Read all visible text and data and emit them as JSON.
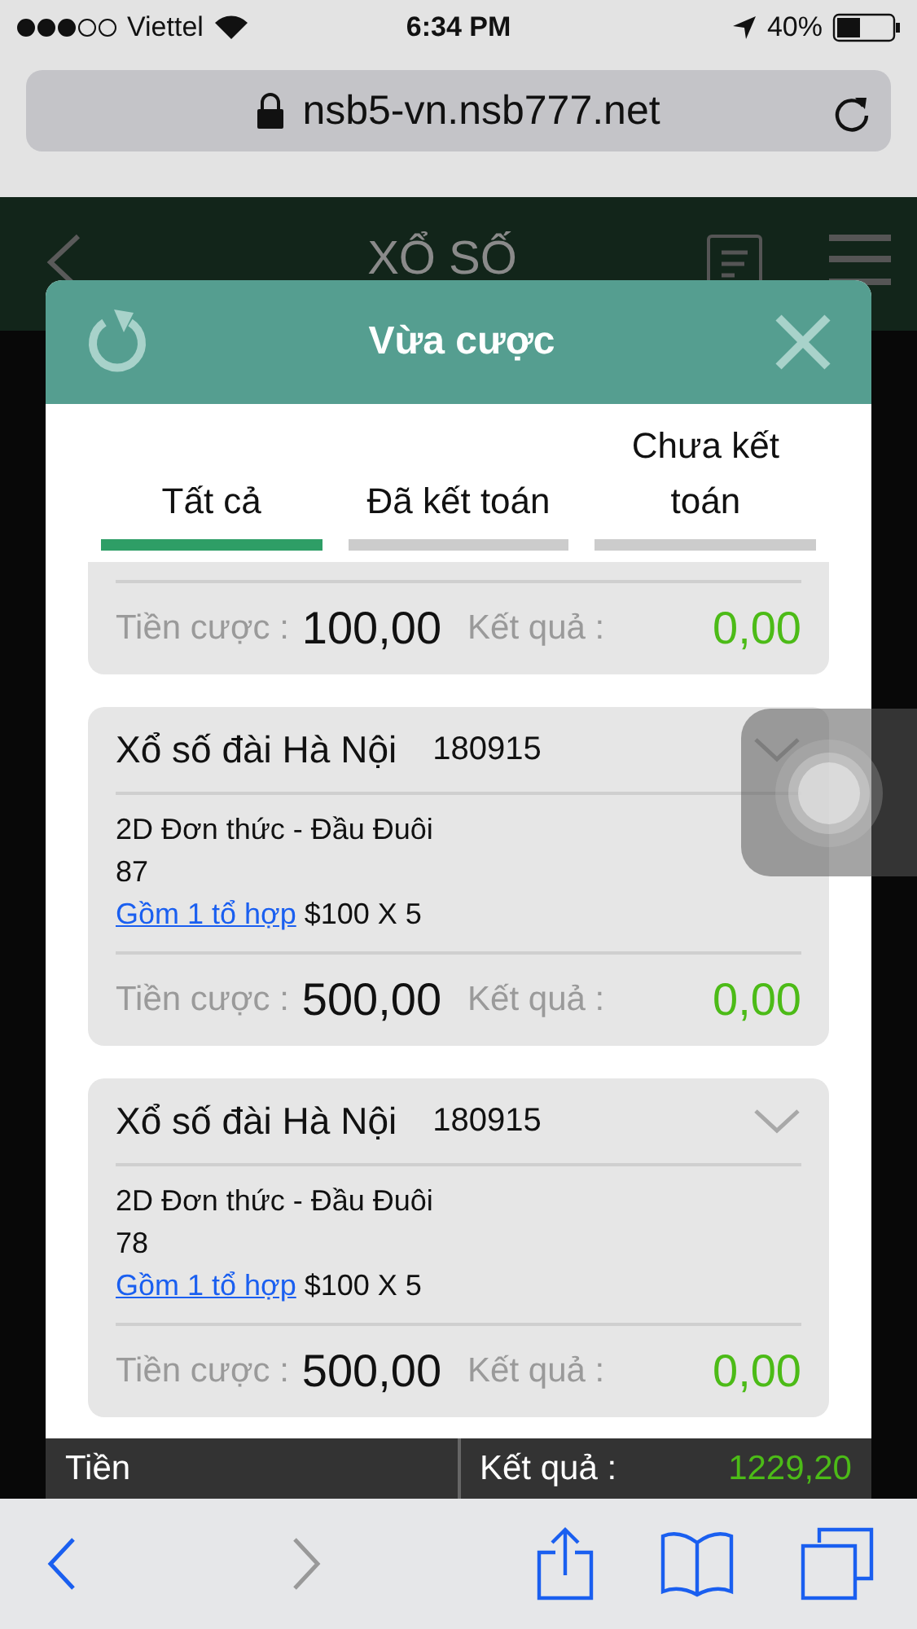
{
  "status_bar": {
    "carrier": "Viettel",
    "time": "6:34 PM",
    "battery": "40%"
  },
  "browser": {
    "url": "nsb5-vn.nsb777.net"
  },
  "app_header": {
    "title": "XỔ SỐ"
  },
  "dialog": {
    "title": "Vừa cược",
    "tabs": [
      {
        "label": "Tất cả",
        "selected": true
      },
      {
        "label": "Đã kết toán",
        "selected": false
      },
      {
        "label": "Chưa kết toán",
        "selected": false
      }
    ],
    "bets": [
      {
        "kind": "partial",
        "stake_label": "Tiền cược :",
        "stake": "100,00",
        "result_label": "Kết quả :",
        "result": "0,00"
      },
      {
        "kind": "full",
        "title": "Xổ số đài Hà Nội",
        "draw": "180915",
        "bet_type": "2D Đơn thức - Đầu Đuôi",
        "numbers": "87",
        "combo_link": "Gồm 1 tổ hợp",
        "amount": "$100 X 5",
        "stake_label": "Tiền cược :",
        "stake": "500,00",
        "result_label": "Kết quả :",
        "result": "0,00"
      },
      {
        "kind": "full",
        "title": "Xổ số đài Hà Nội",
        "draw": "180915",
        "bet_type": "2D Đơn thức - Đầu Đuôi",
        "numbers": "78",
        "combo_link": "Gồm 1 tổ hợp",
        "amount": "$100 X 5",
        "stake_label": "Tiền cược :",
        "stake": "500,00",
        "result_label": "Kết quả :",
        "result": "0,00"
      }
    ],
    "summary": {
      "stake_label": "Tiền",
      "result_label": "Kết quả :",
      "result": "1229,20"
    }
  }
}
